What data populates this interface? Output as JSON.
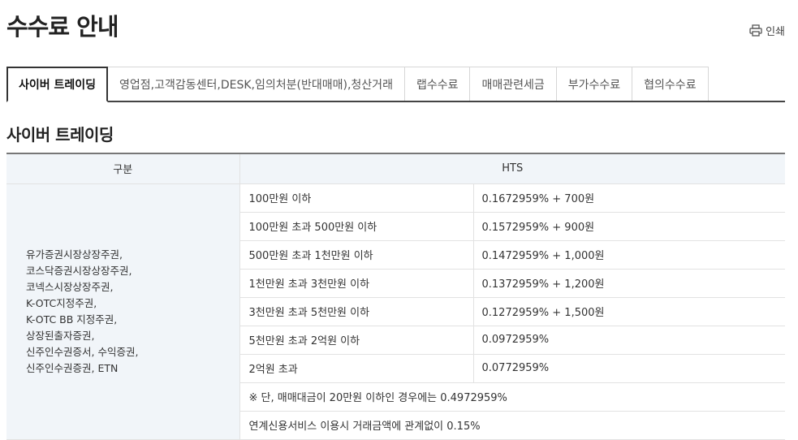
{
  "page": {
    "title": "수수료 안내",
    "print_label": "인쇄"
  },
  "tabs": [
    {
      "label": "사이버 트레이딩",
      "active": true
    },
    {
      "label": "영업점,고객감동센터,DESK,임의처분(반대매매),청산거래",
      "active": false
    },
    {
      "label": "랩수수료",
      "active": false
    },
    {
      "label": "매매관련세금",
      "active": false
    },
    {
      "label": "부가수수료",
      "active": false
    },
    {
      "label": "협의수수료",
      "active": false
    }
  ],
  "section": {
    "title": "사이버 트레이딩"
  },
  "table": {
    "headers": {
      "category": "구분",
      "hts": "HTS"
    },
    "category_lines": [
      "유가증권시장상장주권,",
      "코스닥증권시장상장주권,",
      "코넥스시장상장주권,",
      "K-OTC지정주권,",
      "K-OTC BB 지정주권,",
      "상장된출자증권,",
      "신주인수권증서, 수익증권,",
      "신주인수권증권, ETN"
    ],
    "rows": [
      {
        "range": "100만원 이하",
        "rate": "0.1672959% + 700원"
      },
      {
        "range": "100만원 초과 500만원 이하",
        "rate": "0.1572959% + 900원"
      },
      {
        "range": "500만원 초과 1천만원 이하",
        "rate": "0.1472959% + 1,000원"
      },
      {
        "range": "1천만원 초과 3천만원 이하",
        "rate": "0.1372959% + 1,200원"
      },
      {
        "range": "3천만원 초과 5천만원 이하",
        "rate": "0.1272959% + 1,500원"
      },
      {
        "range": "5천만원 초과 2억원 이하",
        "rate": "0.0972959%"
      },
      {
        "range": "2억원 초과",
        "rate": "0.0772959%"
      }
    ],
    "notes": [
      "※ 단, 매매대금이 20만원 이하인 경우에는 0.4972959%",
      "연계신용서비스 이용시 거래금액에 관계없이 0.15%"
    ]
  }
}
